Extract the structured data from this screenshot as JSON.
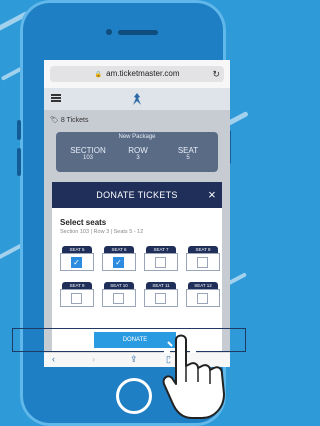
{
  "browser": {
    "url": "am.ticketmaster.com",
    "back_icon": "chevron-left-icon",
    "forward_icon": "chevron-right-icon",
    "share_icon": "share-icon",
    "bookmarks_icon": "book-icon"
  },
  "app": {
    "tickets_count": "8 Tickets",
    "package_label": "New Package",
    "columns": [
      {
        "label": "SECTION",
        "value": "103"
      },
      {
        "label": "ROW",
        "value": "3"
      },
      {
        "label": "SEAT",
        "value": "5"
      }
    ]
  },
  "modal": {
    "title": "DONATE TICKETS",
    "close": "×",
    "select_title": "Select seats",
    "select_sub": "Section 103 | Row 3 | Seats 5 - 12",
    "seats": [
      {
        "label": "SEAT 5",
        "checked": true
      },
      {
        "label": "SEAT 6",
        "checked": true
      },
      {
        "label": "SEAT 7",
        "checked": false
      },
      {
        "label": "SEAT 8",
        "checked": false
      },
      {
        "label": "SEAT 9",
        "checked": false
      },
      {
        "label": "SEAT 10",
        "checked": false
      },
      {
        "label": "SEAT 11",
        "checked": false
      },
      {
        "label": "SEAT 12",
        "checked": false
      }
    ],
    "donate_label": "DONATE"
  },
  "colors": {
    "background": "#2f9ad8",
    "modal_header": "#1f2f5a",
    "accent": "#2a9be0"
  }
}
